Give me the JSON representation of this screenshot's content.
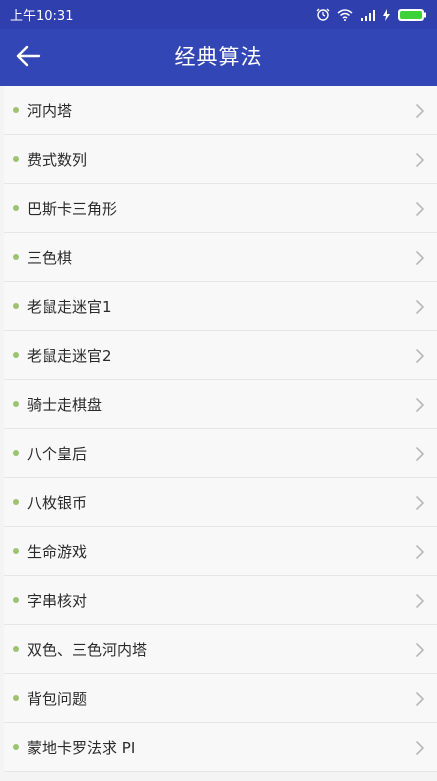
{
  "status_bar": {
    "time": "上午10:31",
    "icons": [
      "alarm-icon",
      "wifi-icon",
      "signal-icon",
      "charging-icon",
      "battery-icon"
    ],
    "colors": {
      "background": "#2f3fae",
      "battery_fill": "#3fd13a"
    }
  },
  "app_bar": {
    "title": "经典算法",
    "back_icon": "arrow-left-icon",
    "colors": {
      "background": "#3346b6",
      "text": "#ffffff"
    }
  },
  "list": {
    "bullet_color": "#9cc36d",
    "chevron_icon": "chevron-right-icon",
    "items": [
      {
        "label": "河内塔"
      },
      {
        "label": "费式数列"
      },
      {
        "label": "巴斯卡三角形"
      },
      {
        "label": "三色棋"
      },
      {
        "label": "老鼠走迷官1"
      },
      {
        "label": "老鼠走迷官2"
      },
      {
        "label": "骑士走棋盘"
      },
      {
        "label": "八个皇后"
      },
      {
        "label": "八枚银币"
      },
      {
        "label": "生命游戏"
      },
      {
        "label": "字串核对"
      },
      {
        "label": "双色、三色河内塔"
      },
      {
        "label": "背包问题"
      },
      {
        "label": "蒙地卡罗法求 PI"
      }
    ]
  }
}
